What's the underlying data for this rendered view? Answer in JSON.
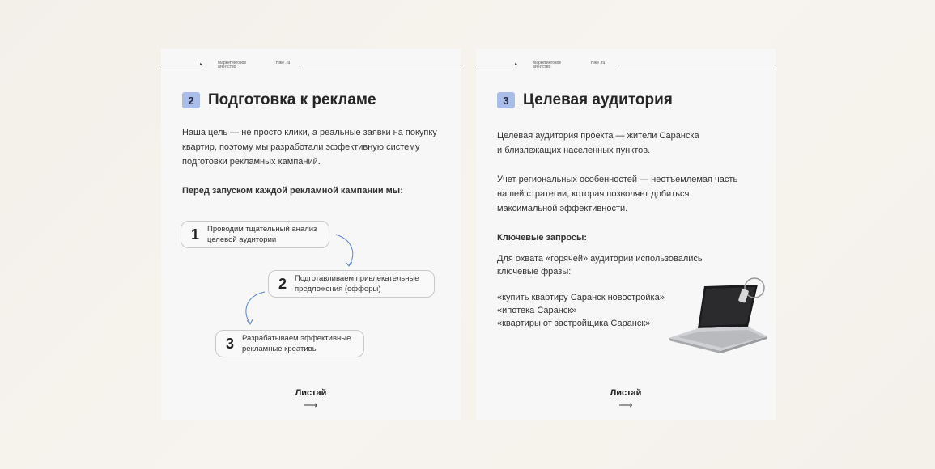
{
  "header": {
    "agency": "Маркетинговое агентство",
    "site": "Hike .ru"
  },
  "slide2": {
    "number": "2",
    "title": "Подготовка к рекламе",
    "intro": "Наша цель — не просто клики, а реальные заявки на покупку квартир, поэтому мы разработали эффективную систему подготовки рекламных кампаний.",
    "subheading": "Перед запуском каждой рекламной кампании мы:",
    "steps": [
      {
        "num": "1",
        "text": "Проводим тщательный анализ\nцелевой аудитории"
      },
      {
        "num": "2",
        "text": "Подготавливаем привлекательные\nпредложения (офферы)"
      },
      {
        "num": "3",
        "text": "Разрабатываем эффективные\nрекламные креативы"
      }
    ],
    "next_label": "Листай",
    "next_arrow": "⟶"
  },
  "slide3": {
    "number": "3",
    "title": "Целевая аудитория",
    "para1": "Целевая аудитория проекта — жители Саранска\nи близлежащих населенных пунктов.",
    "para2": "Учет региональных особенностей — неотъемлемая часть нашей стратегии, которая позволяет добиться максимальной эффективности.",
    "subheading": "Ключевые запросы:",
    "para3": "Для охвата «горячей» аудитории использовались ключевые фразы:",
    "queries": [
      "«купить квартиру Саранск новостройка»",
      "«ипотека Саранск»",
      "«квартиры от застройщика Саранск»"
    ],
    "next_label": "Листай",
    "next_arrow": "⟶"
  },
  "colors": {
    "badge": "#a9bde8",
    "arrow": "#5b82d6",
    "slide_bg": "#f7f7f8"
  }
}
